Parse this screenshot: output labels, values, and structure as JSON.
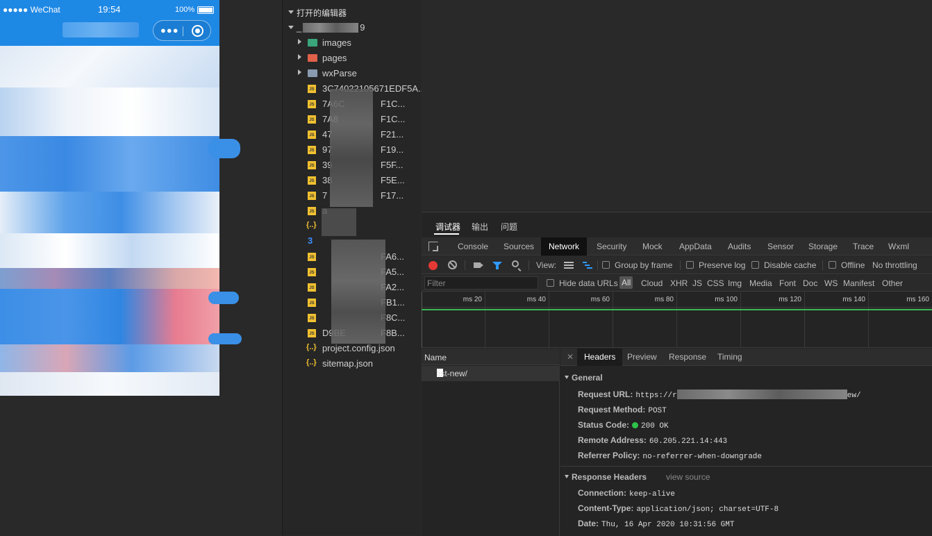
{
  "simulator": {
    "carrier": "●●●●● WeChat",
    "time": "19:54",
    "battery": "100%"
  },
  "explorer": {
    "header": "打开的编辑器",
    "project": "_",
    "project_suffix": "9",
    "items": [
      {
        "type": "folder",
        "name": "images",
        "color": "#3aa57a"
      },
      {
        "type": "folder",
        "name": "pages",
        "color": "#e0604a"
      },
      {
        "type": "folder",
        "name": "wxParse",
        "color": "#8a9bb0"
      },
      {
        "type": "js",
        "name": "3C74022105671EDF5A..."
      },
      {
        "type": "js",
        "name": "7A6C",
        "suffix": "F1C..."
      },
      {
        "type": "js",
        "name": "7A8",
        "suffix": "F1C..."
      },
      {
        "type": "js",
        "name": "47",
        "suffix": "F21..."
      },
      {
        "type": "js",
        "name": "97",
        "suffix": "F19..."
      },
      {
        "type": "js",
        "name": "39",
        "suffix": "F5F..."
      },
      {
        "type": "js",
        "name": "38",
        "suffix": "F5E..."
      },
      {
        "type": "js",
        "name": "7",
        "suffix": "F17..."
      },
      {
        "type": "js",
        "name": "a",
        "suffix": ""
      },
      {
        "type": "json",
        "name": "",
        "suffix": ""
      },
      {
        "type": "css",
        "name": "",
        "suffix": ""
      },
      {
        "type": "js",
        "name": "",
        "suffix": "FA6..."
      },
      {
        "type": "js",
        "name": "",
        "suffix": "FA5..."
      },
      {
        "type": "js",
        "name": "",
        "suffix": "FA2..."
      },
      {
        "type": "js",
        "name": "",
        "suffix": "FB1..."
      },
      {
        "type": "js",
        "name": "",
        "suffix": "F8C..."
      },
      {
        "type": "js",
        "name": "D9BE",
        "suffix": "F8B..."
      },
      {
        "type": "json",
        "name": "project.config.json"
      },
      {
        "type": "json",
        "name": "sitemap.json"
      }
    ]
  },
  "devtools": {
    "top_tabs": [
      "调试器",
      "输出",
      "问题"
    ],
    "panel_tabs": [
      "Console",
      "Sources",
      "Network",
      "Security",
      "Mock",
      "AppData",
      "Audits",
      "Sensor",
      "Storage",
      "Trace",
      "Wxml"
    ],
    "active_panel": "Network",
    "toolbar": {
      "view_label": "View:",
      "group_by_frame": "Group by frame",
      "preserve_log": "Preserve log",
      "disable_cache": "Disable cache",
      "offline": "Offline",
      "throttling": "No throttling"
    },
    "filter": {
      "placeholder": "Filter",
      "hide_data_urls": "Hide data URLs",
      "types": [
        "All",
        "Cloud",
        "XHR",
        "JS",
        "CSS",
        "Img",
        "Media",
        "Font",
        "Doc",
        "WS",
        "Manifest",
        "Other"
      ]
    },
    "timeline_ticks": [
      "20 ms",
      "40 ms",
      "60 ms",
      "80 ms",
      "100 ms",
      "120 ms",
      "140 ms",
      "160 ms"
    ],
    "requests": {
      "header": "Name",
      "rows": [
        "list-new/"
      ]
    },
    "details": {
      "tabs": [
        "Headers",
        "Preview",
        "Response",
        "Timing"
      ],
      "general_title": "General",
      "request_url_label": "Request URL:",
      "request_url_prefix": "https://r",
      "request_url_suffix": "ew/",
      "request_method_label": "Request Method:",
      "request_method": "POST",
      "status_code_label": "Status Code:",
      "status_code": "200 OK",
      "remote_address_label": "Remote Address:",
      "remote_address": "60.205.221.14:443",
      "referrer_policy_label": "Referrer Policy:",
      "referrer_policy": "no-referrer-when-downgrade",
      "response_headers_title": "Response Headers",
      "view_source": "view source",
      "connection_label": "Connection:",
      "connection": "keep-alive",
      "content_type_label": "Content-Type:",
      "content_type": "application/json; charset=UTF-8",
      "date_label": "Date:",
      "date": "Thu, 16 Apr 2020 10:31:56 GMT"
    }
  }
}
